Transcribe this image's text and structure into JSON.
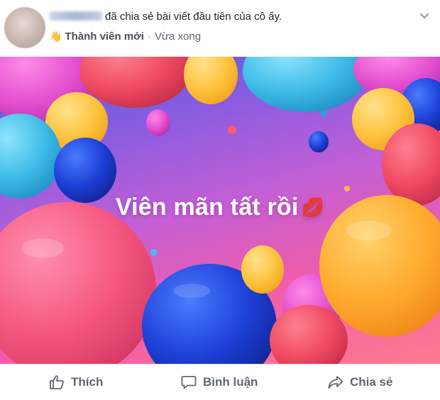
{
  "post": {
    "shared_text": "đã chia sẻ bài viết đầu tiên của cô ấy.",
    "badge": "Thành viên mới",
    "separator": "·",
    "time": "Vừa xong",
    "image_caption": "Viên mãn tất rồi",
    "caption_emoji": "💋",
    "badge_icon": "👋"
  },
  "actions": {
    "like_label": "Thích",
    "comment_label": "Bình luận",
    "share_label": "Chia sẻ"
  },
  "colors": {
    "text": "#1d2129",
    "secondary": "#606770",
    "divider": "#e5e5e5"
  },
  "icons": [
    "chevron-down-icon",
    "thumbs-up-icon",
    "comment-icon",
    "share-icon",
    "wave-hand-icon",
    "lips-icon"
  ]
}
